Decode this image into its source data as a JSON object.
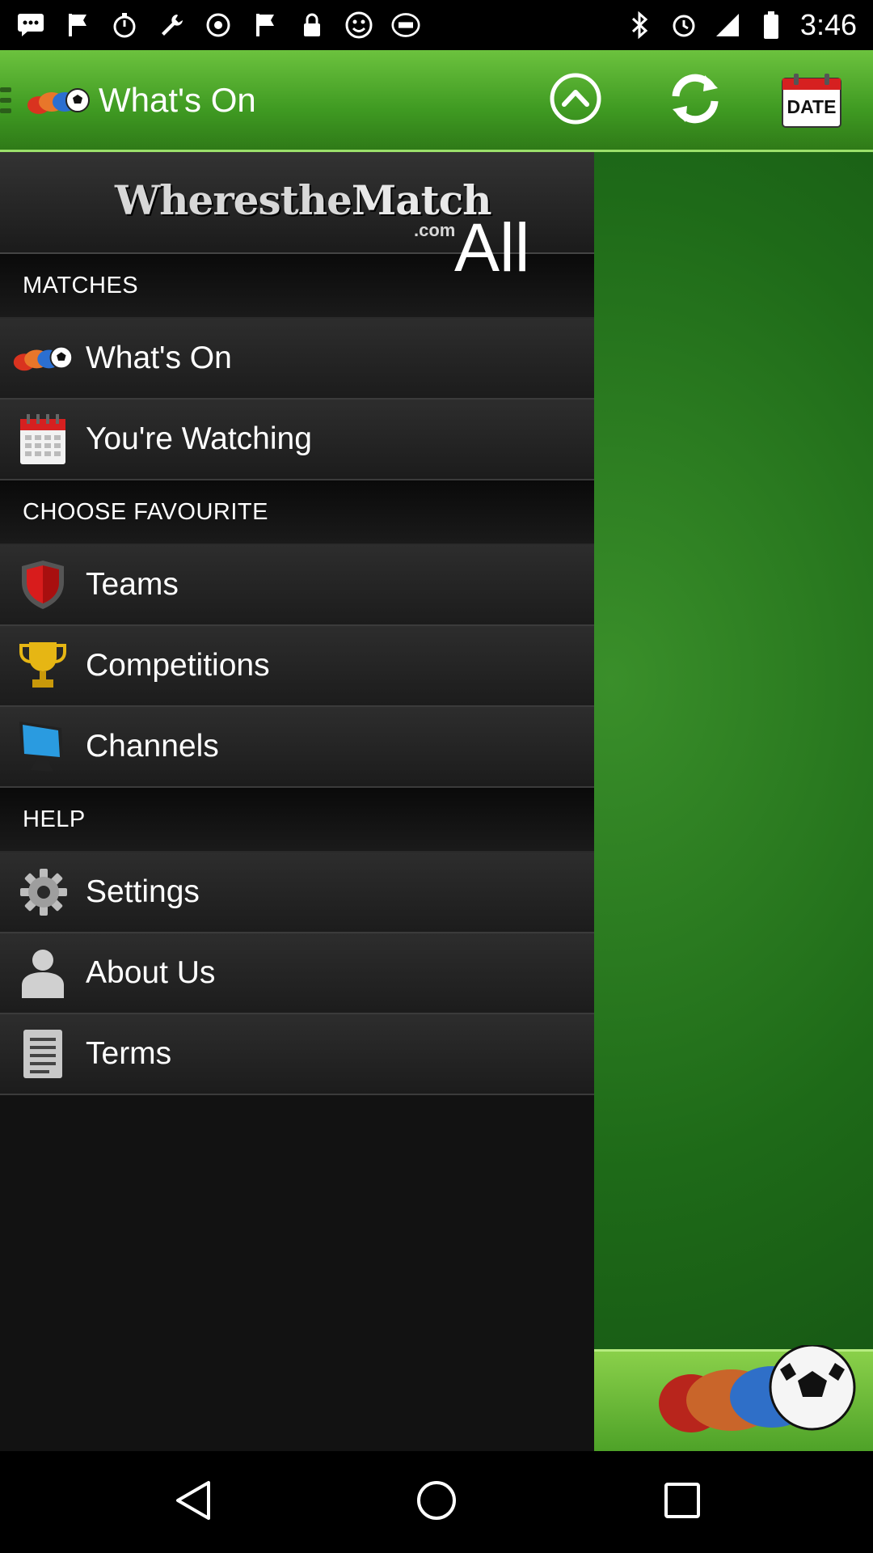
{
  "status_bar": {
    "time": "3:46",
    "left_icons": [
      "chat-icon",
      "flag-icon",
      "stopwatch-icon",
      "wrench-icon",
      "steam-icon",
      "flag-icon",
      "lock-icon",
      "smiley-icon",
      "fox-sports-icon"
    ],
    "right_icons": [
      "bluetooth-icon",
      "alarm-icon",
      "signal-icon",
      "battery-icon"
    ]
  },
  "header": {
    "title": "What's On",
    "buttons": [
      "scroll-up",
      "refresh",
      "date"
    ],
    "date_label": "DATE"
  },
  "drawer": {
    "brand": {
      "name_part1": "Wheres",
      "name_part2": "the",
      "name_part3": "Match",
      "domain": ".com",
      "filter": "All"
    },
    "sections": [
      {
        "title": "MATCHES",
        "items": [
          {
            "label": "What's On",
            "icon": "sports-balls-icon"
          },
          {
            "label": "You're Watching",
            "icon": "calendar-icon"
          }
        ]
      },
      {
        "title": "CHOOSE FAVOURITE",
        "items": [
          {
            "label": "Teams",
            "icon": "shield-icon"
          },
          {
            "label": "Competitions",
            "icon": "trophy-icon"
          },
          {
            "label": "Channels",
            "icon": "monitor-icon"
          }
        ]
      },
      {
        "title": "HELP",
        "items": [
          {
            "label": "Settings",
            "icon": "gear-icon"
          },
          {
            "label": "About Us",
            "icon": "person-icon"
          },
          {
            "label": "Terms",
            "icon": "document-icon"
          }
        ]
      }
    ]
  },
  "colors": {
    "header_green": "#4fa82a",
    "drawer_bg": "#121212",
    "menu_item_bg": "#2a2a2a",
    "background_green": "#1e6a18"
  }
}
